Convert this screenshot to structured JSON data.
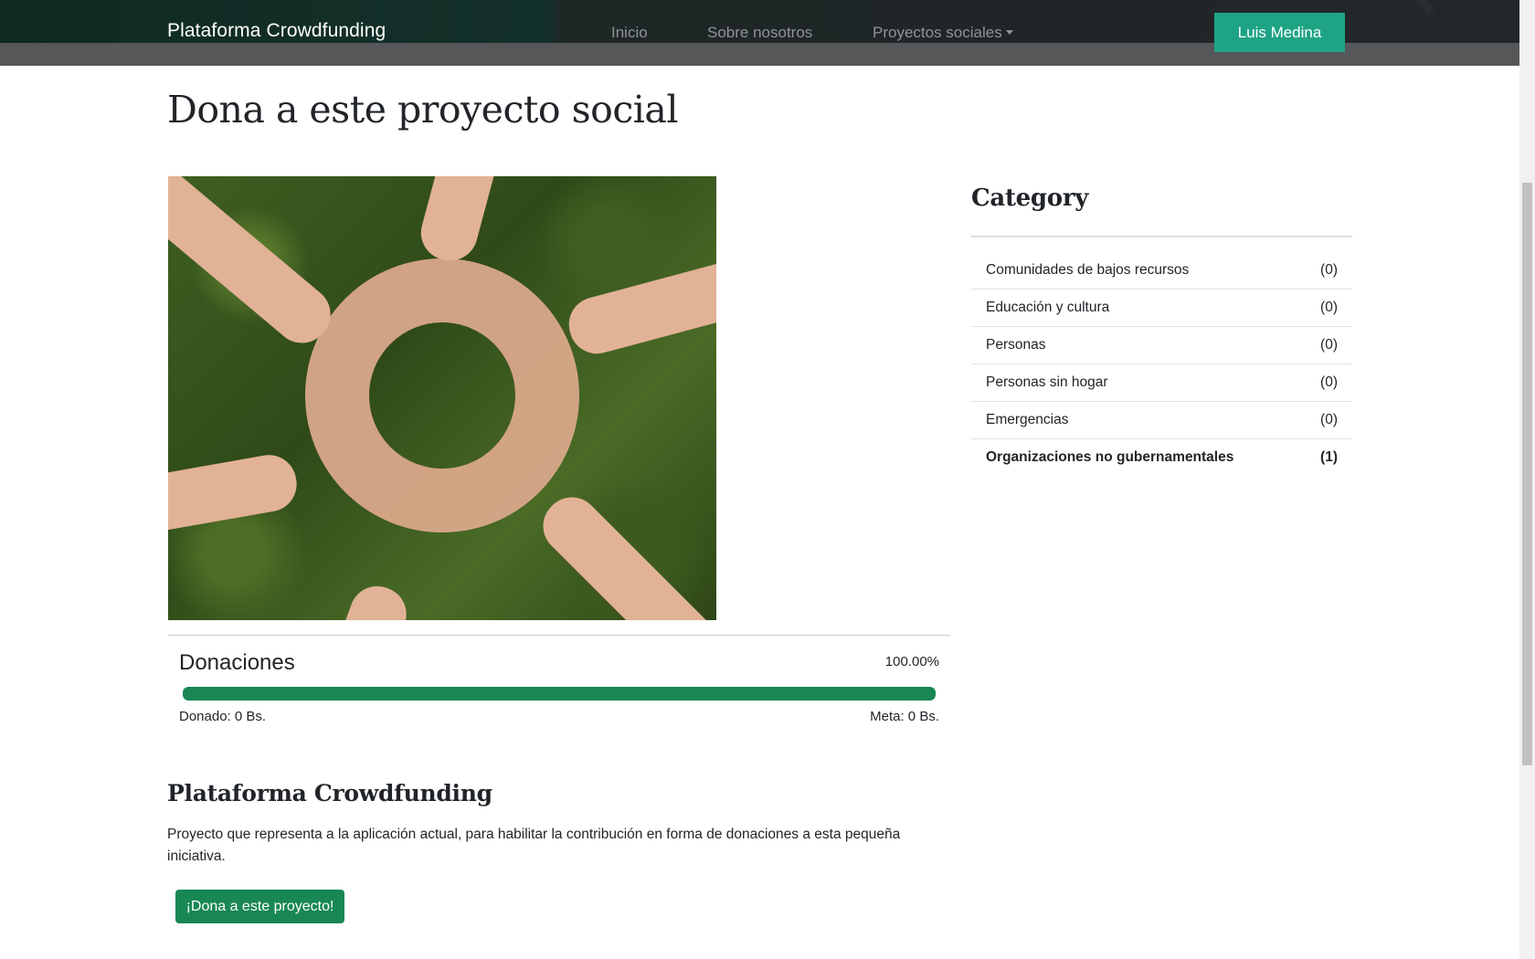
{
  "navbar": {
    "brand": "Plataforma Crowdfunding",
    "links": [
      {
        "label": "Inicio"
      },
      {
        "label": "Sobre nosotros"
      },
      {
        "label": "Proyectos sociales"
      }
    ],
    "user_button": "Luis Medina"
  },
  "page": {
    "title": "Dona a este proyecto social"
  },
  "project": {
    "image_description_icon": "hands-circle-photo",
    "donations_title": "Donaciones",
    "progress_percent_label": "100.00%",
    "progress_fraction": 1.0,
    "donated_label": "Donado: 0 Bs.",
    "goal_label": "Meta: 0 Bs.",
    "name": "Plataforma Crowdfunding",
    "description": "Proyecto que representa a la aplicación actual, para habilitar la contribución en forma de donaciones a esta pequeña iniciativa.",
    "donate_button": "¡Dona a este proyecto!"
  },
  "sidebar": {
    "title": "Category",
    "categories": [
      {
        "name": "Comunidades de bajos recursos",
        "count": "(0)",
        "active": false
      },
      {
        "name": "Educación y cultura",
        "count": "(0)",
        "active": false
      },
      {
        "name": "Personas",
        "count": "(0)",
        "active": false
      },
      {
        "name": "Personas sin hogar",
        "count": "(0)",
        "active": false
      },
      {
        "name": "Emergencias",
        "count": "(0)",
        "active": false
      },
      {
        "name": "Organizaciones no gubernamentales",
        "count": "(1)",
        "active": true
      }
    ]
  },
  "colors": {
    "accent_button": "#1fa385",
    "progress_green": "#198754",
    "navbar_dark": "#222628"
  }
}
